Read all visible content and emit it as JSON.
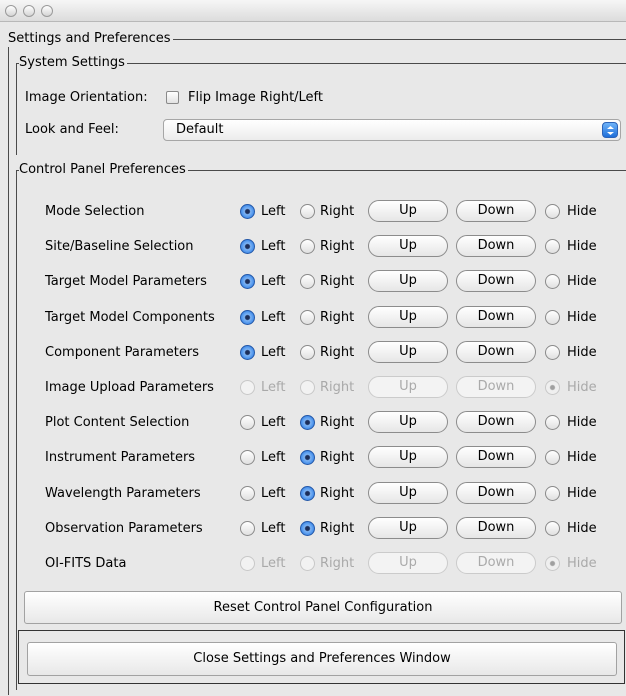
{
  "settings_group": {
    "title": "Settings and Preferences"
  },
  "system_settings": {
    "title": "System Settings",
    "orientation_label": "Image Orientation:",
    "flip_label": "Flip Image Right/Left",
    "look_label": "Look and Feel:",
    "look_value": "Default"
  },
  "control_panel": {
    "title": "Control Panel Preferences",
    "left_label": "Left",
    "right_label": "Right",
    "up_label": "Up",
    "down_label": "Down",
    "hide_label": "Hide",
    "rows": [
      {
        "label": "Mode Selection",
        "selected": "left",
        "enabled": true
      },
      {
        "label": "Site/Baseline Selection",
        "selected": "left",
        "enabled": true
      },
      {
        "label": "Target Model Parameters",
        "selected": "left",
        "enabled": true
      },
      {
        "label": "Target Model Components",
        "selected": "left",
        "enabled": true
      },
      {
        "label": "Component Parameters",
        "selected": "left",
        "enabled": true
      },
      {
        "label": "Image Upload Parameters",
        "selected": "hide",
        "enabled": false
      },
      {
        "label": "Plot Content Selection",
        "selected": "right",
        "enabled": true
      },
      {
        "label": "Instrument Parameters",
        "selected": "right",
        "enabled": true
      },
      {
        "label": "Wavelength Parameters",
        "selected": "right",
        "enabled": true
      },
      {
        "label": "Observation Parameters",
        "selected": "right",
        "enabled": true
      },
      {
        "label": "OI-FITS Data",
        "selected": "hide",
        "enabled": false
      }
    ]
  },
  "reset_button": {
    "label": "Reset Control Panel Configuration"
  },
  "close_button": {
    "label": "Close Settings and Preferences Window"
  }
}
